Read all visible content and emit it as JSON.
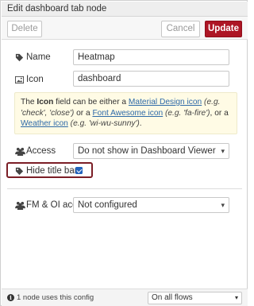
{
  "dialog": {
    "title": "Edit dashboard tab node"
  },
  "toolbar": {
    "delete_label": "Delete",
    "cancel_label": "Cancel",
    "update_label": "Update"
  },
  "form": {
    "name": {
      "label": "Name",
      "value": "Heatmap",
      "icon": "tag-icon"
    },
    "icon": {
      "label": "Icon",
      "value": "dashboard",
      "icon": "image-icon"
    },
    "info": {
      "p1": "The ",
      "field": "Icon",
      "p2": " field can be either a ",
      "link1": "Material Design icon",
      "eg1": " (e.g. 'check', 'close')",
      "p3": " or a ",
      "link2": "Font Awesome icon",
      "eg2": " (e.g. 'fa-fire')",
      "p4": ", or a ",
      "link3": "Weather icon",
      "eg3": " (e.g. 'wi-wu-sunny')",
      "p5": "."
    },
    "access": {
      "label": "Access",
      "value": "Do not show in Dashboard Viewer",
      "icon": "users-icon"
    },
    "hide_title_bar": {
      "label": "Hide title bar",
      "checked": true,
      "icon": "tag-icon"
    },
    "fm_oi_access": {
      "label": "FM & OI access",
      "value": "Not configured",
      "icon": "users-icon"
    }
  },
  "footer": {
    "usage_text": "1 node uses this config",
    "scope_value": "On all flows"
  },
  "colors": {
    "update": "#ad1625",
    "highlight": "#7b1e26",
    "checkbox": "#2363bd",
    "info_bg": "#fffbe5",
    "link": "#2e6aa8"
  }
}
